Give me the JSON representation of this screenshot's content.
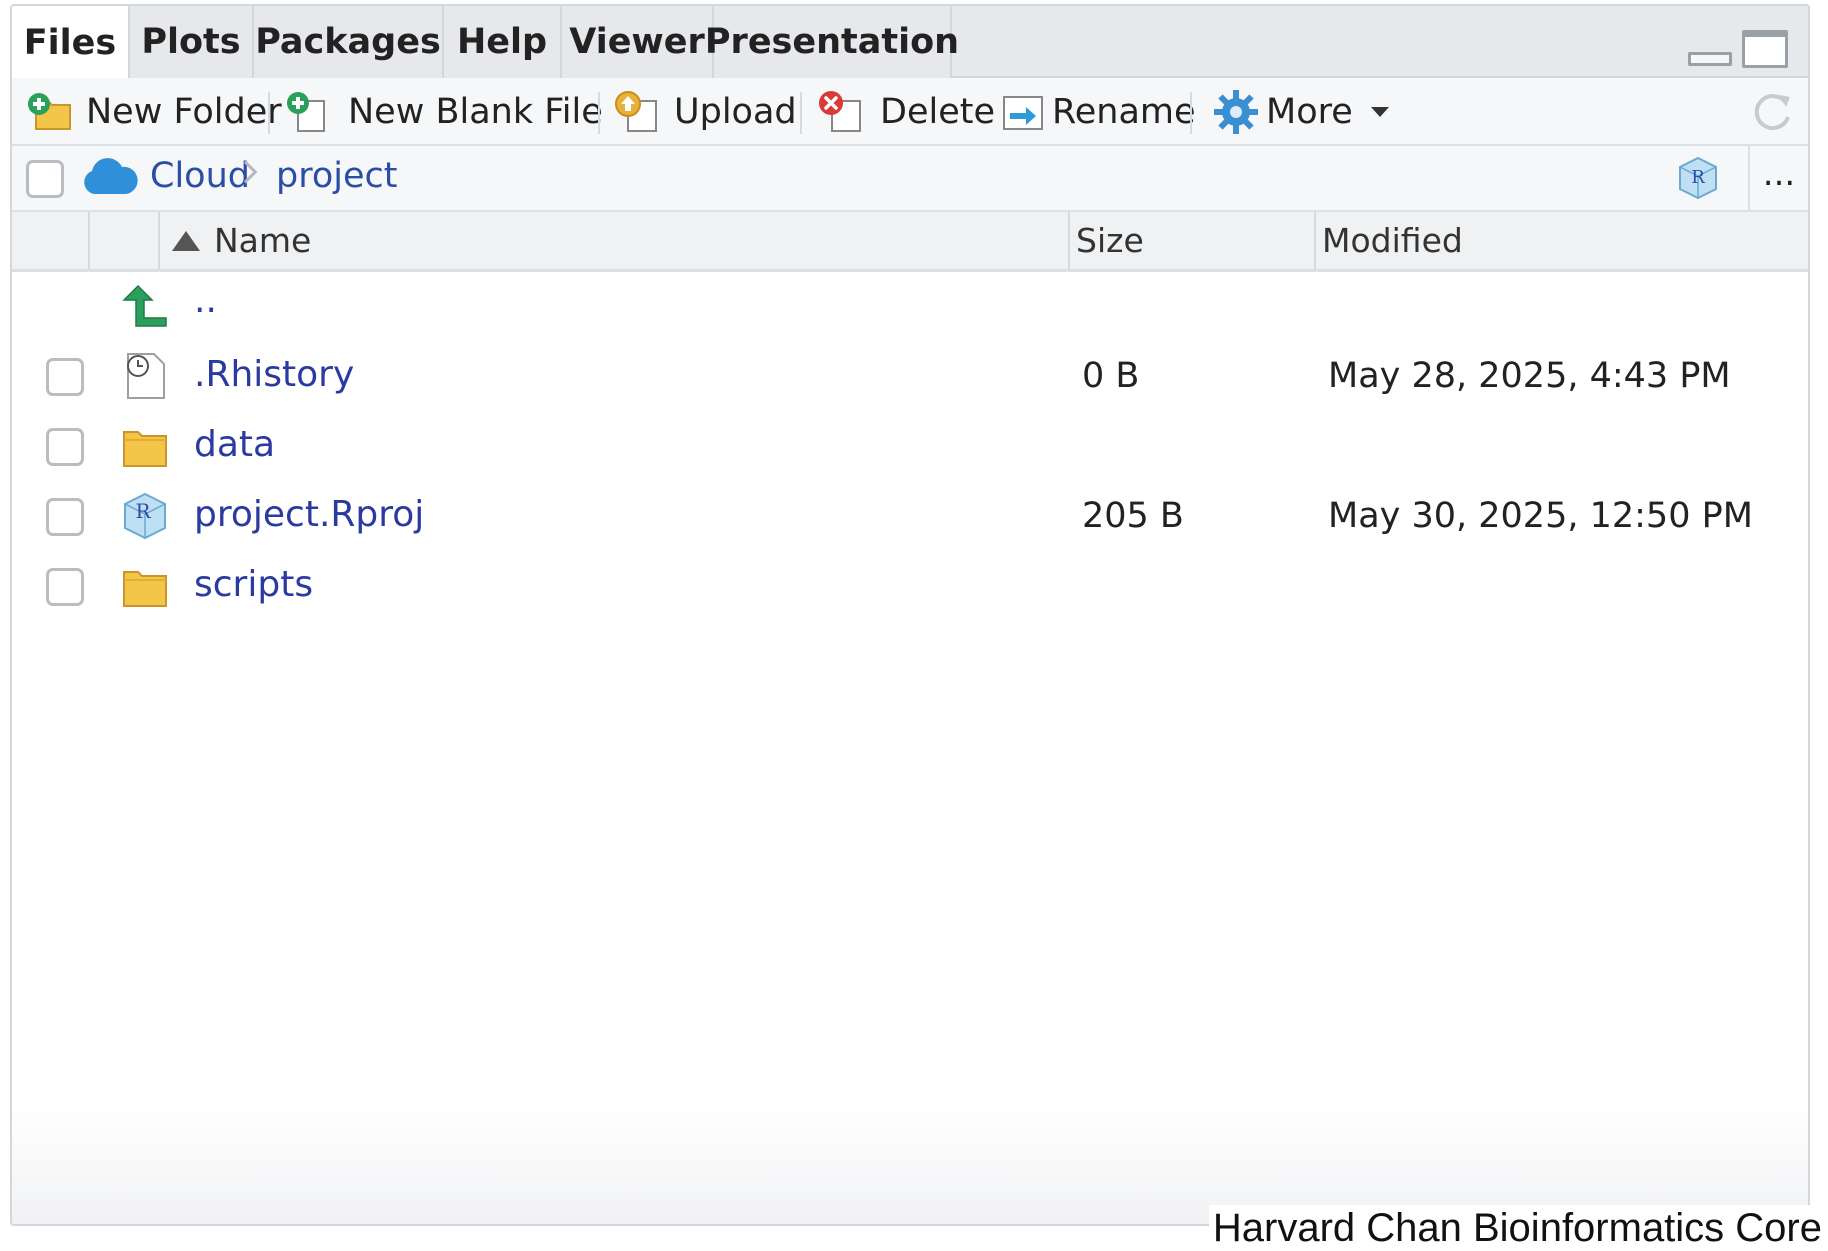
{
  "tabs": [
    {
      "label": "Files",
      "active": true
    },
    {
      "label": "Plots"
    },
    {
      "label": "Packages"
    },
    {
      "label": "Help"
    },
    {
      "label": "Viewer"
    },
    {
      "label": "Presentation"
    }
  ],
  "toolbar": {
    "new_folder": "New Folder",
    "new_blank_file": "New Blank File",
    "upload": "Upload",
    "delete": "Delete",
    "rename": "Rename",
    "more": "More"
  },
  "path": {
    "root": "Cloud",
    "current": "project",
    "more": "..."
  },
  "columns": {
    "name": "Name",
    "size": "Size",
    "modified": "Modified"
  },
  "files": [
    {
      "name": "..",
      "type": "parent",
      "size": "",
      "modified": ""
    },
    {
      "name": ".Rhistory",
      "type": "history",
      "size": "0 B",
      "modified": "May 28, 2025, 4:43 PM"
    },
    {
      "name": "data",
      "type": "folder",
      "size": "",
      "modified": ""
    },
    {
      "name": "project.Rproj",
      "type": "rproj",
      "size": "205 B",
      "modified": "May 30, 2025, 12:50 PM"
    },
    {
      "name": "scripts",
      "type": "folder",
      "size": "",
      "modified": ""
    }
  ],
  "credit": "Harvard Chan Bioinformatics Core",
  "colors": {
    "link": "#2a3aa0",
    "crumb": "#2a4ea8",
    "folder": "#f3c64a",
    "parent_arrow": "#2aa05a"
  }
}
